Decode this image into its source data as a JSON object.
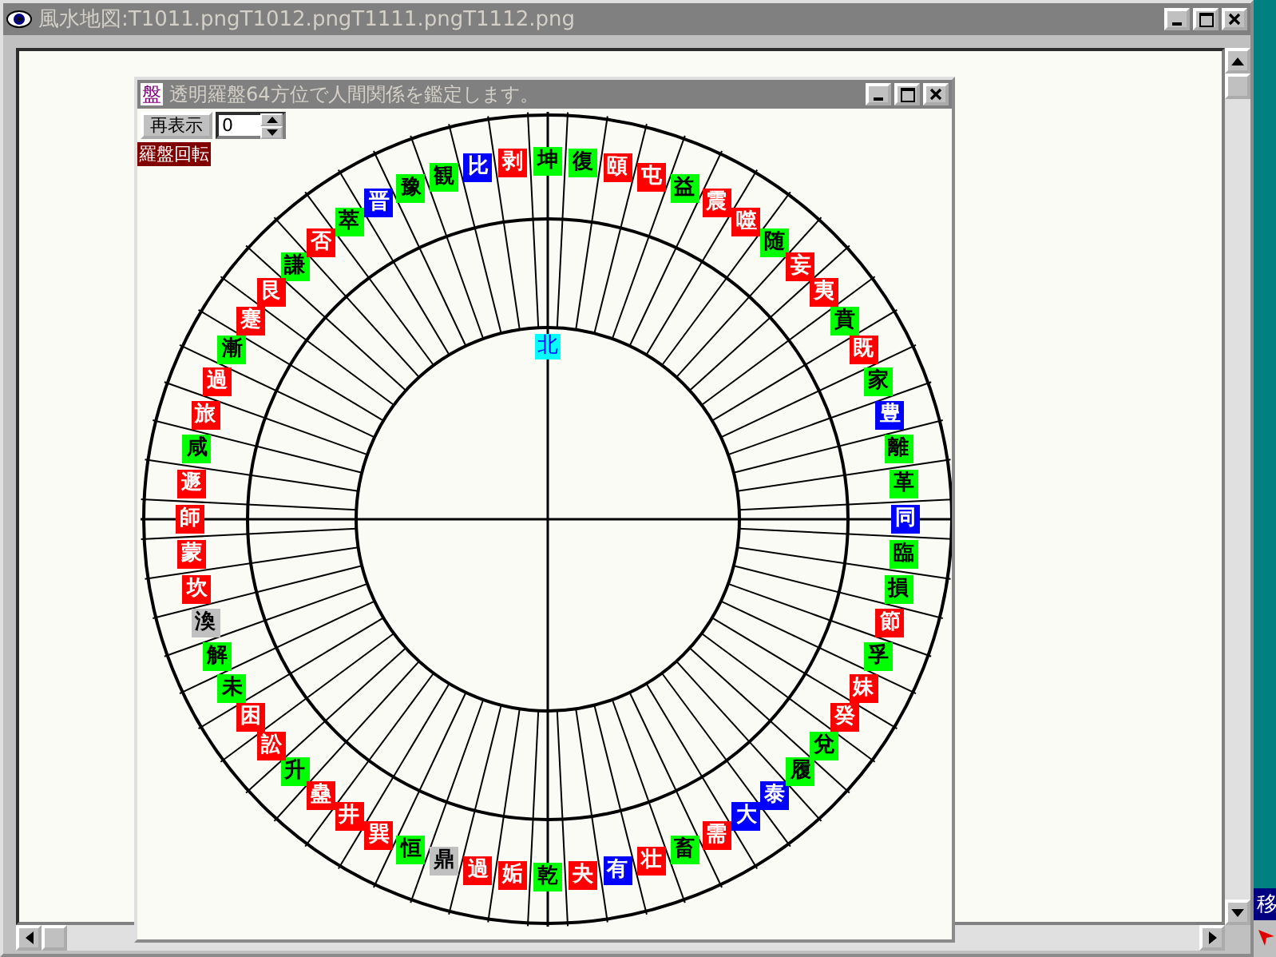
{
  "main_window": {
    "title": "風水地図:T1011.pngT1012.pngT1111.pngT1112.png"
  },
  "compass_window": {
    "icon_label": "盤",
    "title": "透明羅盤64方位で人間関係を鑑定します。",
    "redraw_button": "再表示",
    "rotation": {
      "value": "0",
      "label": "羅盤回転"
    },
    "north_label": "北",
    "top_arc_hexagrams": [
      {
        "name": "謙",
        "color": "#00ff00"
      },
      {
        "name": "否",
        "color": "#ff0000"
      },
      {
        "name": "萃",
        "color": "#00ff00"
      },
      {
        "name": "晋",
        "color": "#0000ff"
      },
      {
        "name": "豫",
        "color": "#00ff00"
      },
      {
        "name": "観",
        "color": "#00ff00"
      },
      {
        "name": "比",
        "color": "#0000ff"
      },
      {
        "name": "剥",
        "color": "#ff0000"
      },
      {
        "name": "坤",
        "color": "#00ff00"
      },
      {
        "name": "復",
        "color": "#00ff00"
      },
      {
        "name": "頤",
        "color": "#ff0000"
      },
      {
        "name": "屯",
        "color": "#ff0000"
      },
      {
        "name": "益",
        "color": "#00ff00"
      },
      {
        "name": "震",
        "color": "#ff0000"
      },
      {
        "name": "噬",
        "color": "#ff0000"
      },
      {
        "name": "随",
        "color": "#00ff00"
      },
      {
        "name": "妄",
        "color": "#ff0000"
      }
    ],
    "right_arc_hexagrams": [
      {
        "name": "夷",
        "color": "#ff0000"
      },
      {
        "name": "賁",
        "color": "#00ff00"
      },
      {
        "name": "既",
        "color": "#ff0000"
      },
      {
        "name": "家",
        "color": "#00ff00"
      },
      {
        "name": "豊",
        "color": "#0000ff"
      },
      {
        "name": "離",
        "color": "#00ff00"
      },
      {
        "name": "革",
        "color": "#00ff00"
      },
      {
        "name": "同",
        "color": "#0000ff"
      },
      {
        "name": "臨",
        "color": "#00ff00"
      },
      {
        "name": "損",
        "color": "#00ff00"
      },
      {
        "name": "節",
        "color": "#ff0000"
      },
      {
        "name": "孚",
        "color": "#00ff00"
      },
      {
        "name": "妹",
        "color": "#ff0000"
      },
      {
        "name": "癸",
        "color": "#ff0000"
      },
      {
        "name": "兌",
        "color": "#00ff00"
      }
    ],
    "bottom_arc_hexagrams": [
      {
        "name": "升",
        "color": "#00ff00"
      },
      {
        "name": "蠱",
        "color": "#ff0000"
      },
      {
        "name": "井",
        "color": "#ff0000"
      },
      {
        "name": "巽",
        "color": "#ff0000"
      },
      {
        "name": "恒",
        "color": "#00ff00"
      },
      {
        "name": "鼎",
        "color": "#c0c0c0"
      },
      {
        "name": "過",
        "color": "#ff0000"
      },
      {
        "name": "姤",
        "color": "#ff0000"
      },
      {
        "name": "乾",
        "color": "#00ff00"
      },
      {
        "name": "夬",
        "color": "#ff0000"
      },
      {
        "name": "有",
        "color": "#0000ff"
      },
      {
        "name": "壮",
        "color": "#ff0000"
      },
      {
        "name": "畜",
        "color": "#00ff00"
      },
      {
        "name": "需",
        "color": "#ff0000"
      },
      {
        "name": "大",
        "color": "#0000ff"
      },
      {
        "name": "泰",
        "color": "#0000ff"
      },
      {
        "name": "履",
        "color": "#00ff00"
      }
    ],
    "left_arc_hexagrams": [
      {
        "name": "艮",
        "color": "#ff0000"
      },
      {
        "name": "蹇",
        "color": "#ff0000"
      },
      {
        "name": "漸",
        "color": "#00ff00"
      },
      {
        "name": "過",
        "color": "#ff0000"
      },
      {
        "name": "旅",
        "color": "#ff0000"
      },
      {
        "name": "咸",
        "color": "#00ff00"
      },
      {
        "name": "遯",
        "color": "#ff0000"
      },
      {
        "name": "師",
        "color": "#ff0000"
      },
      {
        "name": "蒙",
        "color": "#ff0000"
      },
      {
        "name": "坎",
        "color": "#ff0000"
      },
      {
        "name": "渙",
        "color": "#c0c0c0"
      },
      {
        "name": "解",
        "color": "#00ff00"
      },
      {
        "name": "未",
        "color": "#00ff00"
      },
      {
        "name": "困",
        "color": "#ff0000"
      },
      {
        "name": "訟",
        "color": "#ff0000"
      }
    ]
  },
  "side_tab": {
    "label": "移"
  }
}
